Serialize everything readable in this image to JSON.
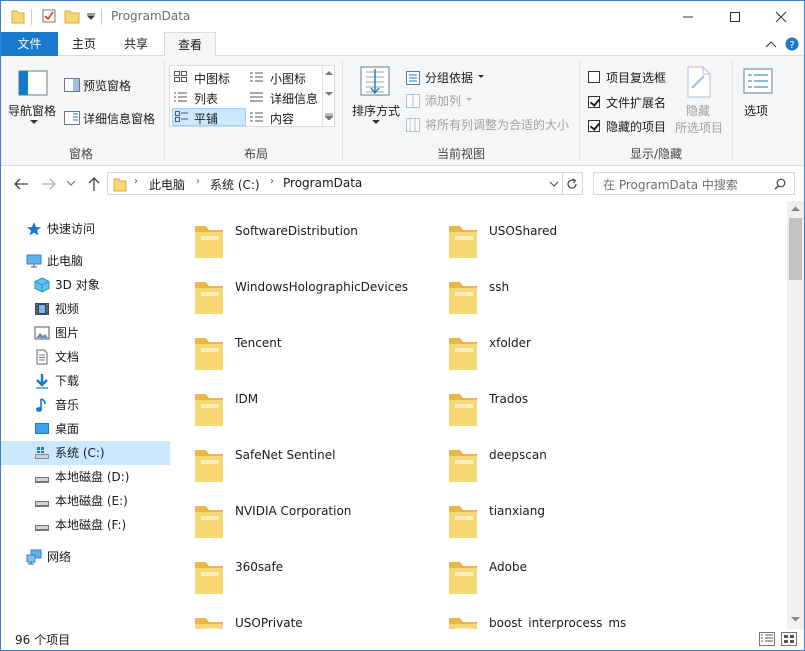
{
  "window": {
    "title": "ProgramData",
    "controls": {
      "minimize": "minimize",
      "maximize": "maximize",
      "close": "close"
    }
  },
  "ribbon": {
    "tabs": [
      "文件",
      "主页",
      "共享",
      "查看"
    ],
    "active_tab": "查看",
    "pane": {
      "nav_pane_label": "导航窗格",
      "preview_label": "预览窗格",
      "details_label": "详细信息窗格",
      "group": "窗格"
    },
    "layout": {
      "items": [
        "中图标",
        "小图标",
        "列表",
        "详细信息",
        "平铺",
        "内容"
      ],
      "selected": "平铺",
      "group": "布局"
    },
    "current_view": {
      "sort_label": "排序方式",
      "group_by": "分组依据",
      "add_column": "添加列",
      "fit_columns": "将所有列调整为合适的大小",
      "group": "当前视图"
    },
    "show_hide": {
      "checkbox_item": "项目复选框",
      "ext": "文件扩展名",
      "hidden": "隐藏的项目",
      "checkbox_item_checked": false,
      "ext_checked": true,
      "hidden_checked": true,
      "hide_selected_1": "隐藏",
      "hide_selected_2": "所选项目",
      "group": "显示/隐藏"
    },
    "options": "选项"
  },
  "address": {
    "crumbs": [
      "此电脑",
      "系统 (C:)",
      "ProgramData"
    ],
    "search_placeholder": "在 ProgramData 中搜索"
  },
  "nav": {
    "quick_access": "快速访问",
    "this_pc": "此电脑",
    "items": [
      "3D 对象",
      "视频",
      "图片",
      "文档",
      "下载",
      "音乐",
      "桌面",
      "系统 (C:)",
      "本地磁盘 (D:)",
      "本地磁盘 (E:)",
      "本地磁盘 (F:)"
    ],
    "network": "网络",
    "selected": "系统 (C:)"
  },
  "folders": {
    "left": [
      "SoftwareDistribution",
      "WindowsHolographicDevices",
      "Tencent",
      "IDM",
      "SafeNet Sentinel",
      "NVIDIA Corporation",
      "360safe",
      "USOPrivate"
    ],
    "right": [
      "USOShared",
      "ssh",
      "xfolder",
      "Trados",
      "deepscan",
      "tianxiang",
      "Adobe",
      "boost_interprocess_ms"
    ]
  },
  "status": {
    "count": "96 个项目"
  },
  "colors": {
    "accent": "#1979ca",
    "folder": "#f8d775",
    "folder_dark": "#e8b94a",
    "selection": "#cce8ff"
  }
}
